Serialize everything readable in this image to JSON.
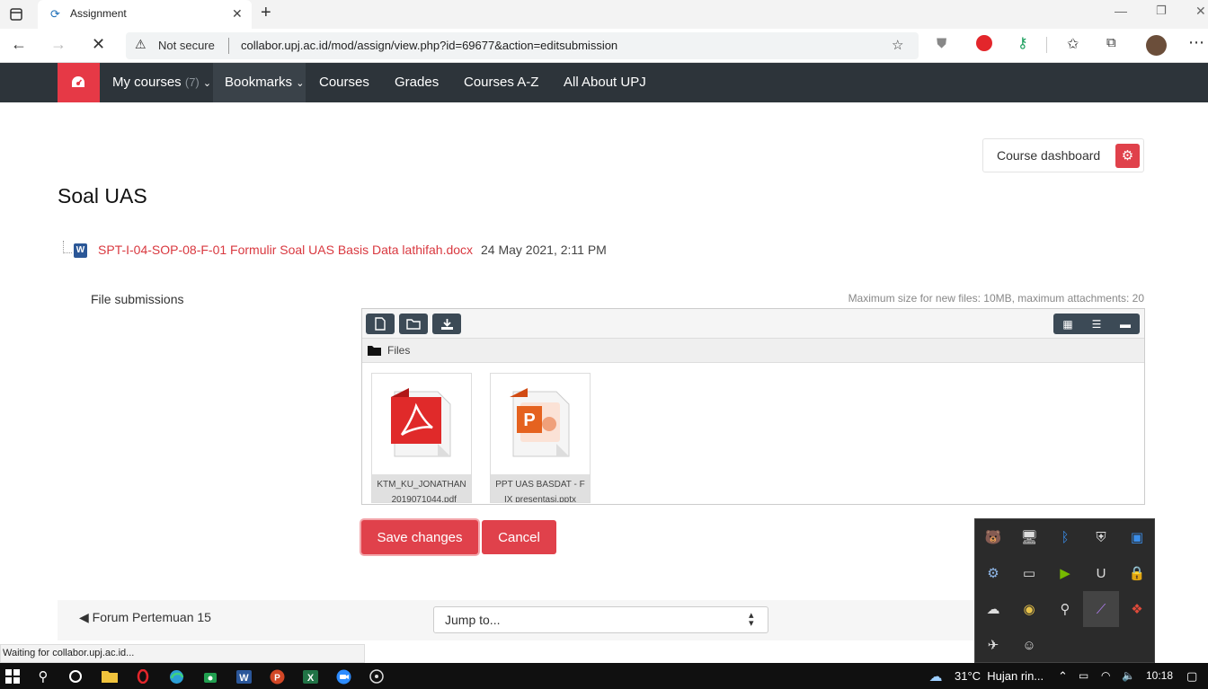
{
  "browser": {
    "tab_title": "Assignment",
    "security_label": "Not secure",
    "url": "collabor.upj.ac.id/mod/assign/view.php?id=69677&action=editsubmission",
    "status_text": "Waiting for collabor.upj.ac.id..."
  },
  "nav": {
    "items": [
      {
        "label": "My courses",
        "badge": "(7)"
      },
      {
        "label": "Bookmarks"
      },
      {
        "label": "Courses"
      },
      {
        "label": "Grades"
      },
      {
        "label": "Courses A-Z"
      },
      {
        "label": "All About UPJ"
      }
    ]
  },
  "page": {
    "title": "Soal UAS",
    "course_dashboard_label": "Course dashboard",
    "attachment": {
      "name": "SPT-I-04-SOP-08-F-01 Formulir Soal UAS Basis Data lathifah.docx",
      "date": "24 May 2021, 2:11 PM"
    },
    "file_submissions_label": "File submissions",
    "max_size_text": "Maximum size for new files: 10MB, maximum attachments: 20",
    "folder_label": "Files",
    "files": [
      {
        "name": "KTM_KU_JONATHAN_2019071044.pdf",
        "icon": "pdf-icon"
      },
      {
        "name": "PPT UAS BASDAT - FIX presentasi.pptx",
        "icon": "pptx-icon"
      }
    ],
    "save_label": "Save changes",
    "cancel_label": "Cancel",
    "prev_link": "◀ Forum Pertemuan 15",
    "jump_placeholder": "Jump to..."
  },
  "taskbar": {
    "weather": "31°C  Hujan rin...",
    "time": "10:18"
  },
  "colors": {
    "accent_red": "#e0414b",
    "navbar": "#2d343a",
    "link_red": "#d9383f"
  }
}
